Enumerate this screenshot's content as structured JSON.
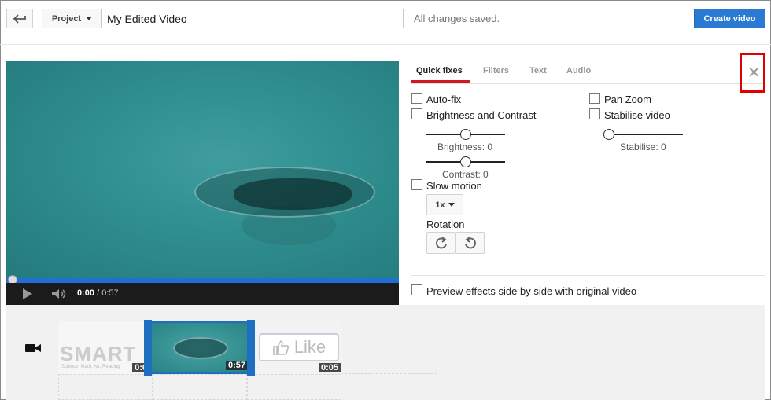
{
  "header": {
    "back_icon": "back-arrow-icon",
    "project_label": "Project",
    "title_value": "My Edited Video",
    "status_text": "All changes saved.",
    "create_label": "Create video"
  },
  "player": {
    "current_time": "0:00",
    "separator": " / ",
    "duration": "0:57",
    "progress_fraction": 0.0,
    "play_icon": "play-icon",
    "volume_icon": "volume-icon"
  },
  "tabs": [
    {
      "label": "Quick fixes",
      "active": true
    },
    {
      "label": "Filters",
      "active": false
    },
    {
      "label": "Text",
      "active": false
    },
    {
      "label": "Audio",
      "active": false
    }
  ],
  "close_icon": "close-icon",
  "quick_fixes": {
    "autofix_label": "Auto-fix",
    "brightness_contrast_label": "Brightness and Contrast",
    "brightness_label": "Brightness: 0",
    "brightness_value": 0,
    "contrast_label": "Contrast: 0",
    "contrast_value": 0,
    "slow_motion_label": "Slow motion",
    "speed_value": "1x",
    "rotation_label": "Rotation",
    "pan_zoom_label": "Pan Zoom",
    "stabilise_label": "Stabilise video",
    "stabilise_value_label": "Stabilise: 0",
    "stabilise_value": 0,
    "preview_label": "Preview effects side by side with original video",
    "rotate_right_icon": "rotate-clockwise-icon",
    "rotate_left_icon": "rotate-counterclockwise-icon"
  },
  "timeline": {
    "camera_icon": "video-camera-icon",
    "clips": [
      {
        "time": "0:0",
        "logo": "SMART",
        "logo_sub": "Science, Math, Art, Reading"
      },
      {
        "time": "0:57"
      },
      {
        "time": "0:05",
        "like_text": "Like"
      }
    ]
  },
  "colors": {
    "accent_blue": "#2a7ad3",
    "tab_underline_red": "#cc181e",
    "close_highlight": "#e00000"
  }
}
